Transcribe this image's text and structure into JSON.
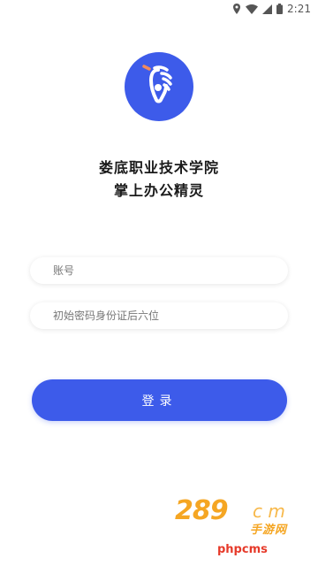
{
  "status_bar": {
    "time": "2:21",
    "icons": [
      "location-icon",
      "wifi-icon",
      "signal-icon",
      "battery-icon"
    ]
  },
  "app": {
    "logo_icon": "hand-logo-icon",
    "title_line1": "娄底职业技术学院",
    "title_line2": "掌上办公精灵"
  },
  "form": {
    "account_placeholder": "账号",
    "password_placeholder": "初始密码身份证后六位",
    "login_label": "登录"
  },
  "watermark": {
    "big": "289",
    "com": "c m",
    "cn": "手游网",
    "text": "phpcms"
  },
  "colors": {
    "primary": "#3d5bea",
    "background": "#ffffff"
  }
}
